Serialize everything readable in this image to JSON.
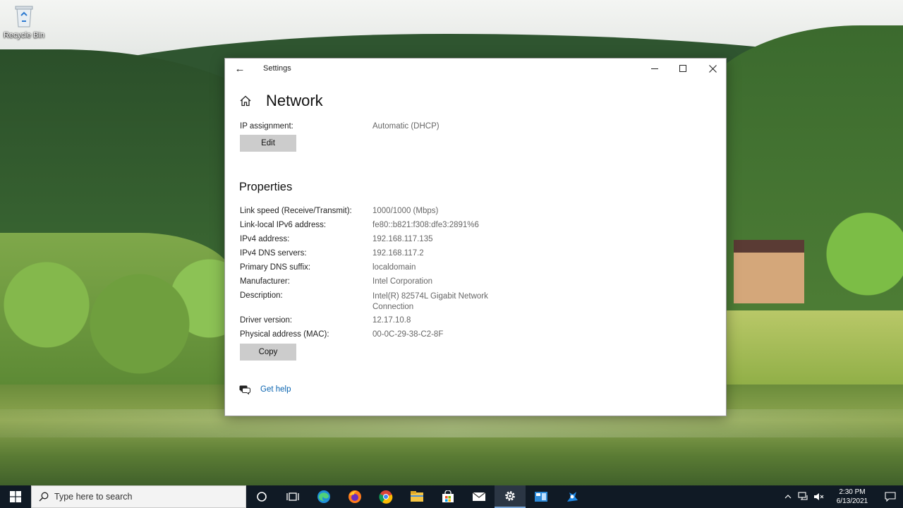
{
  "desktop": {
    "recycle_bin_label": "Recycle Bin"
  },
  "window": {
    "app_title": "Settings",
    "page_title": "Network",
    "ip_assignment": {
      "label": "IP assignment:",
      "value": "Automatic (DHCP)",
      "edit_label": "Edit"
    },
    "properties_title": "Properties",
    "properties": [
      {
        "label": "Link speed (Receive/Transmit):",
        "value": "1000/1000 (Mbps)"
      },
      {
        "label": "Link-local IPv6 address:",
        "value": "fe80::b821:f308:dfe3:2891%6"
      },
      {
        "label": "IPv4 address:",
        "value": "192.168.117.135"
      },
      {
        "label": "IPv4 DNS servers:",
        "value": "192.168.117.2"
      },
      {
        "label": "Primary DNS suffix:",
        "value": "localdomain"
      },
      {
        "label": "Manufacturer:",
        "value": "Intel Corporation"
      },
      {
        "label": "Description:",
        "value": "Intel(R) 82574L Gigabit Network",
        "value_line2": "Connection"
      },
      {
        "label": "Driver version:",
        "value": "12.17.10.8"
      },
      {
        "label": "Physical address (MAC):",
        "value": "00-0C-29-38-C2-8F"
      }
    ],
    "copy_label": "Copy",
    "get_help_label": "Get help"
  },
  "taskbar": {
    "search_placeholder": "Type here to search",
    "time": "2:30 PM",
    "date": "6/13/2021",
    "apps": [
      "cortana-icon",
      "task-view-icon",
      "edge-icon",
      "firefox-icon",
      "chrome-icon",
      "file-explorer-icon",
      "store-icon",
      "mail-icon",
      "settings-icon",
      "network-app-icon",
      "vm-tools-icon"
    ]
  },
  "colors": {
    "accent": "#0a64b0",
    "button_gray": "#cccccc",
    "taskbar_bg": "#101a25"
  }
}
